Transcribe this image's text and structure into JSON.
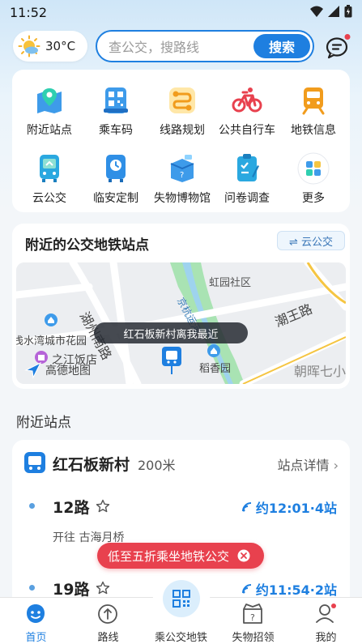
{
  "status_bar": {
    "time": "11:52"
  },
  "header": {
    "weather_icon": "sun-icon",
    "temperature": "30°C",
    "search_placeholder": "查公交，搜路线",
    "search_button": "搜索",
    "message_icon": "chat-bubble-icon"
  },
  "services": [
    {
      "label": "附近站点",
      "icon": "map-pin-icon"
    },
    {
      "label": "乘车码",
      "icon": "qr-ride-icon"
    },
    {
      "label": "线路规划",
      "icon": "route-plan-icon"
    },
    {
      "label": "公共自行车",
      "icon": "bicycle-icon"
    },
    {
      "label": "地铁信息",
      "icon": "metro-train-icon"
    },
    {
      "label": "云公交",
      "icon": "cloud-bus-icon"
    },
    {
      "label": "临安定制",
      "icon": "custom-bus-icon"
    },
    {
      "label": "失物博物馆",
      "icon": "lost-box-icon"
    },
    {
      "label": "问卷调查",
      "icon": "survey-clipboard-icon"
    },
    {
      "label": "更多",
      "icon": "more-grid-icon"
    }
  ],
  "nearby_map": {
    "title": "附近的公交地铁站点",
    "switch_button": "⇌ 云公交",
    "tooltip": "红石板新村离我最近",
    "labels": {
      "community": "虹园社区",
      "canal": "京杭运河",
      "road_chaowang": "潮王路",
      "road_huzhou": "湖州南路",
      "garden": "浅水湾城市花园",
      "hotel": "之江饭店",
      "daoxiang": "稻香园",
      "chaohui": "朝晖七小",
      "map_brand": "高德地图"
    }
  },
  "nearby_section_title": "附近站点",
  "stop": {
    "name": "红石板新村",
    "distance": "200米",
    "detail_link": "站点详情",
    "routes": [
      {
        "name": "12路",
        "direction": "开往 古海月桥",
        "eta": "约12:01·4站"
      },
      {
        "name": "19路",
        "direction": "",
        "eta": "约11:54·2站"
      }
    ]
  },
  "promo_banner": "低至五折乘坐地铁公交",
  "bottom_nav": [
    {
      "label": "首页",
      "icon": "home-face-icon",
      "active": true
    },
    {
      "label": "路线",
      "icon": "route-arrow-icon",
      "active": false
    },
    {
      "label": "乘公交地铁",
      "icon": "qr-code-icon",
      "active": false
    },
    {
      "label": "失物招领",
      "icon": "lost-found-box-icon",
      "active": false
    },
    {
      "label": "我的",
      "icon": "profile-icon",
      "active": false
    }
  ],
  "colors": {
    "accent": "#1e7fe0",
    "promo": "#e8414e",
    "eta": "#1e7fe0"
  }
}
